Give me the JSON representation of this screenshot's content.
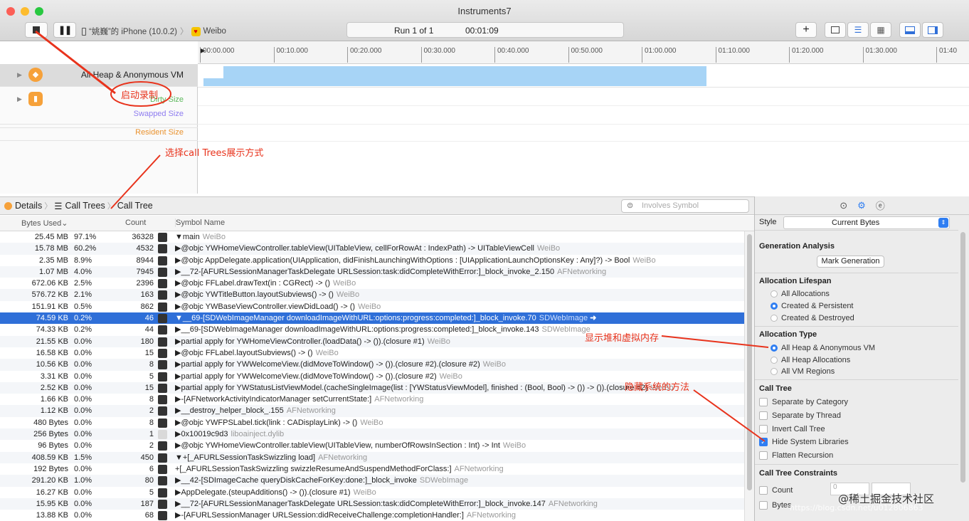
{
  "window": {
    "title": "Instruments7"
  },
  "toolbar": {
    "stop_icon": "stop-icon",
    "pause_icon": "pause-icon",
    "device": "“姚巍”的 iPhone (10.0.2)",
    "app": "Weibo",
    "run": "Run 1 of 1",
    "elapsed": "00:01:09",
    "add": "+"
  },
  "ruler": {
    "ticks": [
      "00:00.000",
      "00:10.000",
      "00:20.000",
      "00:30.000",
      "00:40.000",
      "00:50.000",
      "01:00.000",
      "01:10.000",
      "01:20.000",
      "01:30.000",
      "01:40"
    ]
  },
  "tracks": {
    "heap_vm": "All Heap & Anonymous VM",
    "dirty": "Dirty Size",
    "swapped": "Swapped Size",
    "resident": "Resident Size"
  },
  "detail": {
    "details": "Details",
    "call_trees": "Call Trees",
    "call_tree": "Call Tree",
    "involves_placeholder": "Involves Symbol"
  },
  "columns": {
    "bytes": "Bytes Used",
    "count": "Count",
    "symbol": "Symbol Name"
  },
  "rows": [
    {
      "bytes": "25.45 MB",
      "pct": "97.1%",
      "count": "36328",
      "sym": "▼main",
      "lib": "WeiBo"
    },
    {
      "bytes": "15.78 MB",
      "pct": "60.2%",
      "count": "4532",
      "sym": "▶@objc YWHomeViewController.tableView(UITableView, cellForRowAt : IndexPath) -> UITableViewCell",
      "lib": "WeiBo"
    },
    {
      "bytes": "2.35 MB",
      "pct": "8.9%",
      "count": "8944",
      "sym": "▶@objc AppDelegate.application(UIApplication, didFinishLaunchingWithOptions : [UIApplicationLaunchOptionsKey : Any]?) -> Bool",
      "lib": "WeiBo"
    },
    {
      "bytes": "1.07 MB",
      "pct": "4.0%",
      "count": "7945",
      "sym": "▶__72-[AFURLSessionManagerTaskDelegate URLSession:task:didCompleteWithError:]_block_invoke_2.150",
      "lib": "AFNetworking"
    },
    {
      "bytes": "672.06 KB",
      "pct": "2.5%",
      "count": "2396",
      "sym": "▶@objc FFLabel.drawText(in : CGRect) -> ()",
      "lib": "WeiBo"
    },
    {
      "bytes": "576.72 KB",
      "pct": "2.1%",
      "count": "163",
      "sym": "▶@objc YWTitleButton.layoutSubviews() -> ()",
      "lib": "WeiBo"
    },
    {
      "bytes": "151.91 KB",
      "pct": "0.5%",
      "count": "862",
      "sym": "▶@objc YWBaseViewController.viewDidLoad() -> ()",
      "lib": "WeiBo"
    },
    {
      "bytes": "74.59 KB",
      "pct": "0.2%",
      "count": "46",
      "sym": "▼__69-[SDWebImageManager downloadImageWithURL:options:progress:completed:]_block_invoke.70",
      "lib": "SDWebImage"
    },
    {
      "bytes": "74.33 KB",
      "pct": "0.2%",
      "count": "44",
      "sym": "   ▶__69-[SDWebImageManager downloadImageWithURL:options:progress:completed:]_block_invoke.143",
      "lib": "SDWebImage"
    },
    {
      "bytes": "21.55 KB",
      "pct": "0.0%",
      "count": "180",
      "sym": "▶partial apply for YWHomeViewController.(loadData() -> ()).(closure #1)",
      "lib": "WeiBo"
    },
    {
      "bytes": "16.58 KB",
      "pct": "0.0%",
      "count": "15",
      "sym": "▶@objc FFLabel.layoutSubviews() -> ()",
      "lib": "WeiBo"
    },
    {
      "bytes": "10.56 KB",
      "pct": "0.0%",
      "count": "8",
      "sym": "▶partial apply for YWWelcomeView.(didMoveToWindow() -> ()).(closure #2).(closure #2)",
      "lib": "WeiBo"
    },
    {
      "bytes": "3.31 KB",
      "pct": "0.0%",
      "count": "5",
      "sym": "▶partial apply for YWWelcomeView.(didMoveToWindow() -> ()).(closure #2)",
      "lib": "WeiBo"
    },
    {
      "bytes": "2.52 KB",
      "pct": "0.0%",
      "count": "15",
      "sym": "▶partial apply for YWStatusListViewModel.(cacheSingleImage(list : [YWStatusViewModel], finished : (Bool, Bool) -> ()) -> ()).(closure #2)",
      "lib": "WeiBo"
    },
    {
      "bytes": "1.66 KB",
      "pct": "0.0%",
      "count": "8",
      "sym": "▶-[AFNetworkActivityIndicatorManager setCurrentState:]",
      "lib": "AFNetworking"
    },
    {
      "bytes": "1.12 KB",
      "pct": "0.0%",
      "count": "2",
      "sym": "▶__destroy_helper_block_.155",
      "lib": "AFNetworking"
    },
    {
      "bytes": "480 Bytes",
      "pct": "0.0%",
      "count": "8",
      "sym": "▶@objc YWFPSLabel.tick(link : CADisplayLink) -> ()",
      "lib": "WeiBo"
    },
    {
      "bytes": "256 Bytes",
      "pct": "0.0%",
      "count": "1",
      "sym": "▶0x10019c9d3",
      "lib": "liboainject.dylib"
    },
    {
      "bytes": "96 Bytes",
      "pct": "0.0%",
      "count": "2",
      "sym": "▶@objc YWHomeViewController.tableView(UITableView, numberOfRowsInSection : Int) -> Int",
      "lib": "WeiBo"
    },
    {
      "bytes": "408.59 KB",
      "pct": "1.5%",
      "count": "450",
      "sym": "▼+[_AFURLSessionTaskSwizzling load]",
      "lib": "AFNetworking"
    },
    {
      "bytes": "192 Bytes",
      "pct": "0.0%",
      "count": "6",
      "sym": "   +[_AFURLSessionTaskSwizzling swizzleResumeAndSuspendMethodForClass:]",
      "lib": "AFNetworking"
    },
    {
      "bytes": "291.20 KB",
      "pct": "1.0%",
      "count": "80",
      "sym": "▶__42-[SDImageCache queryDiskCacheForKey:done:]_block_invoke",
      "lib": "SDWebImage"
    },
    {
      "bytes": "16.27 KB",
      "pct": "0.0%",
      "count": "5",
      "sym": "▶AppDelegate.(steupAdditions() -> ()).(closure #1)",
      "lib": "WeiBo"
    },
    {
      "bytes": "15.95 KB",
      "pct": "0.0%",
      "count": "187",
      "sym": "▶__72-[AFURLSessionManagerTaskDelegate URLSession:task:didCompleteWithError:]_block_invoke.147",
      "lib": "AFNetworking"
    },
    {
      "bytes": "13.88 KB",
      "pct": "0.0%",
      "count": "68",
      "sym": "▶-[AFURLSessionManager URLSession:didReceiveChallenge:completionHandler:]",
      "lib": "AFNetworking"
    }
  ],
  "inspector": {
    "style_label": "Style",
    "style_value": "Current Bytes",
    "gen_title": "Generation Analysis",
    "mark_gen": "Mark Generation",
    "lifespan_title": "Allocation Lifespan",
    "lifespan": [
      "All Allocations",
      "Created & Persistent",
      "Created & Destroyed"
    ],
    "type_title": "Allocation Type",
    "types": [
      "All Heap & Anonymous VM",
      "All Heap Allocations",
      "All VM Regions"
    ],
    "calltree_title": "Call Tree",
    "checks": [
      "Separate by Category",
      "Separate by Thread",
      "Invert Call Tree",
      "Hide System Libraries",
      "Flatten Recursion"
    ],
    "constraints_title": "Call Tree Constraints",
    "constraints": [
      "Count",
      "Bytes"
    ],
    "count_min": "0"
  },
  "annotations": {
    "start": "启动录制",
    "calltrees": "选择call Trees展示方式",
    "heapvm": "显示堆和虚拟内存",
    "hide": "隐藏系统的方法"
  },
  "watermark": {
    "brand": "@稀土掘金技术社区",
    "url": "https://blog.csdn.net/u012806863"
  },
  "colors": {
    "accent": "#2f6fd8",
    "annotation": "#e8331c",
    "graph": "#a7d4f6",
    "track_icon": "#f6a13a"
  }
}
